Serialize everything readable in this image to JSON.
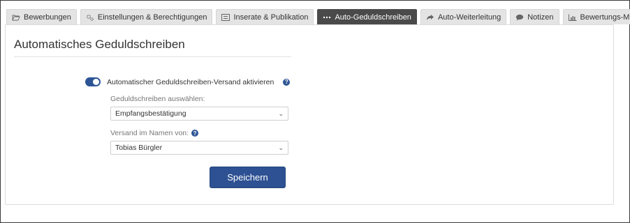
{
  "tabs": [
    {
      "label": "Bewerbungen",
      "icon": "folder-open-icon"
    },
    {
      "label": "Einstellungen & Berechtigungen",
      "icon": "gears-icon"
    },
    {
      "label": "Inserate & Publikation",
      "icon": "list-alt-icon"
    },
    {
      "label": "Auto-Geduldschreiben",
      "icon": "ellipsis-icon",
      "active": true
    },
    {
      "label": "Auto-Weiterleitung",
      "icon": "share-arrow-icon"
    },
    {
      "label": "Notizen",
      "icon": "comment-icon"
    },
    {
      "label": "Bewertungs-Matrix",
      "icon": "bar-chart-icon"
    }
  ],
  "main": {
    "heading": "Automatisches Geduldschreiben",
    "toggle": {
      "label": "Automatischer Geduldschreiben-Versand aktivieren",
      "on": true
    },
    "template_field": {
      "label": "Geduldschreiben auswählen:",
      "value": "Empfangsbestätigung"
    },
    "sender_field": {
      "label": "Versand im Namen von:",
      "value": "Tobias Bürgler"
    },
    "save_label": "Speichern",
    "help_glyph": "?"
  },
  "colors": {
    "accent": "#2d5193",
    "active_tab": "#4a4a4a",
    "tab_bg": "#e4e4e4"
  }
}
